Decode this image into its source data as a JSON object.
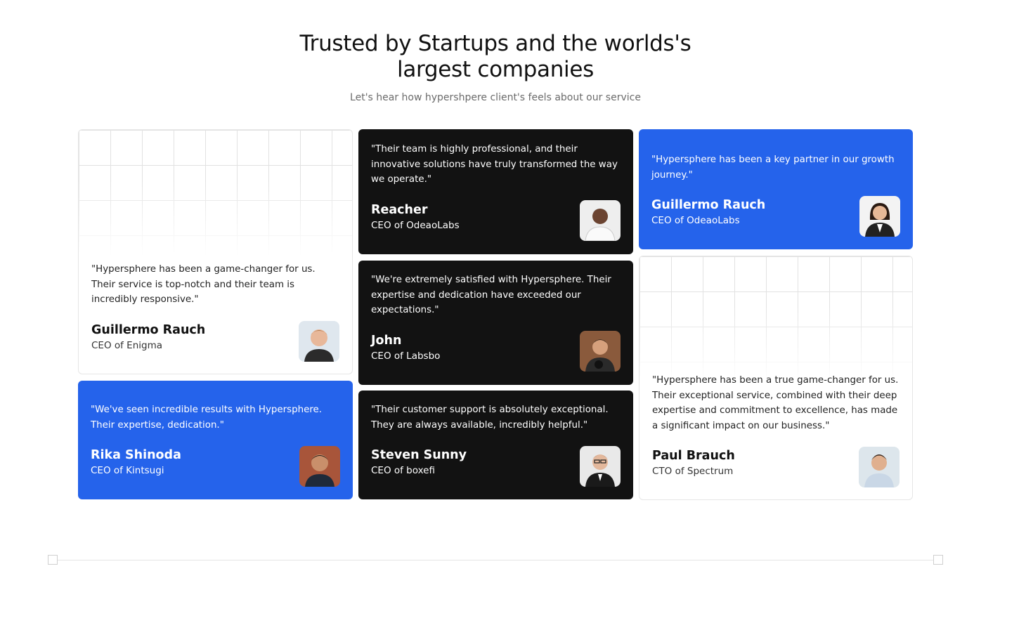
{
  "header": {
    "title": "Trusted by Startups and the worlds's largest companies",
    "subtitle": "Let's hear how hypershpere client's feels about our service"
  },
  "testimonials": [
    {
      "quote": "\"Hypersphere has been a game-changer for us. Their service is top-notch and their team is incredibly responsive.\"",
      "name": "Guillermo Rauch",
      "role": "CEO of Enigma",
      "theme": "white",
      "avatar_icon": "man-avatar-icon"
    },
    {
      "quote": "\"We've seen incredible results with Hypersphere. Their expertise, dedication.\"",
      "name": "Rika Shinoda",
      "role": "CEO of Kintsugi",
      "theme": "blue",
      "avatar_icon": "man-avatar-icon"
    },
    {
      "quote": "\"Their team is highly professional, and their innovative solutions have truly transformed the way we operate.\"",
      "name": "Reacher",
      "role": "CEO of OdeaoLabs",
      "theme": "dark",
      "avatar_icon": "woman-avatar-icon"
    },
    {
      "quote": "\"We're extremely satisfied with Hypersphere. Their expertise and dedication have exceeded our expectations.\"",
      "name": "John",
      "role": "CEO of Labsbo",
      "theme": "dark",
      "avatar_icon": "man-avatar-icon"
    },
    {
      "quote": "\"Their customer support is absolutely exceptional. They are always available, incredibly helpful.\"",
      "name": "Steven Sunny",
      "role": "CEO of boxefi",
      "theme": "dark",
      "avatar_icon": "man-avatar-icon"
    },
    {
      "quote": "\"Hypersphere has been a key partner in our growth journey.\"",
      "name": "Guillermo Rauch",
      "role": "CEO of OdeaoLabs",
      "theme": "blue",
      "avatar_icon": "woman-avatar-icon"
    },
    {
      "quote": "\"Hypersphere has been a true game-changer for us. Their exceptional service, combined with their deep expertise and commitment to excellence, has made a significant impact on our business.\"",
      "name": "Paul Brauch",
      "role": "CTO of Spectrum",
      "theme": "white",
      "avatar_icon": "man-avatar-icon"
    }
  ],
  "colors": {
    "blue": "#2563eb",
    "dark": "#121212",
    "border": "#e6e6e6"
  }
}
